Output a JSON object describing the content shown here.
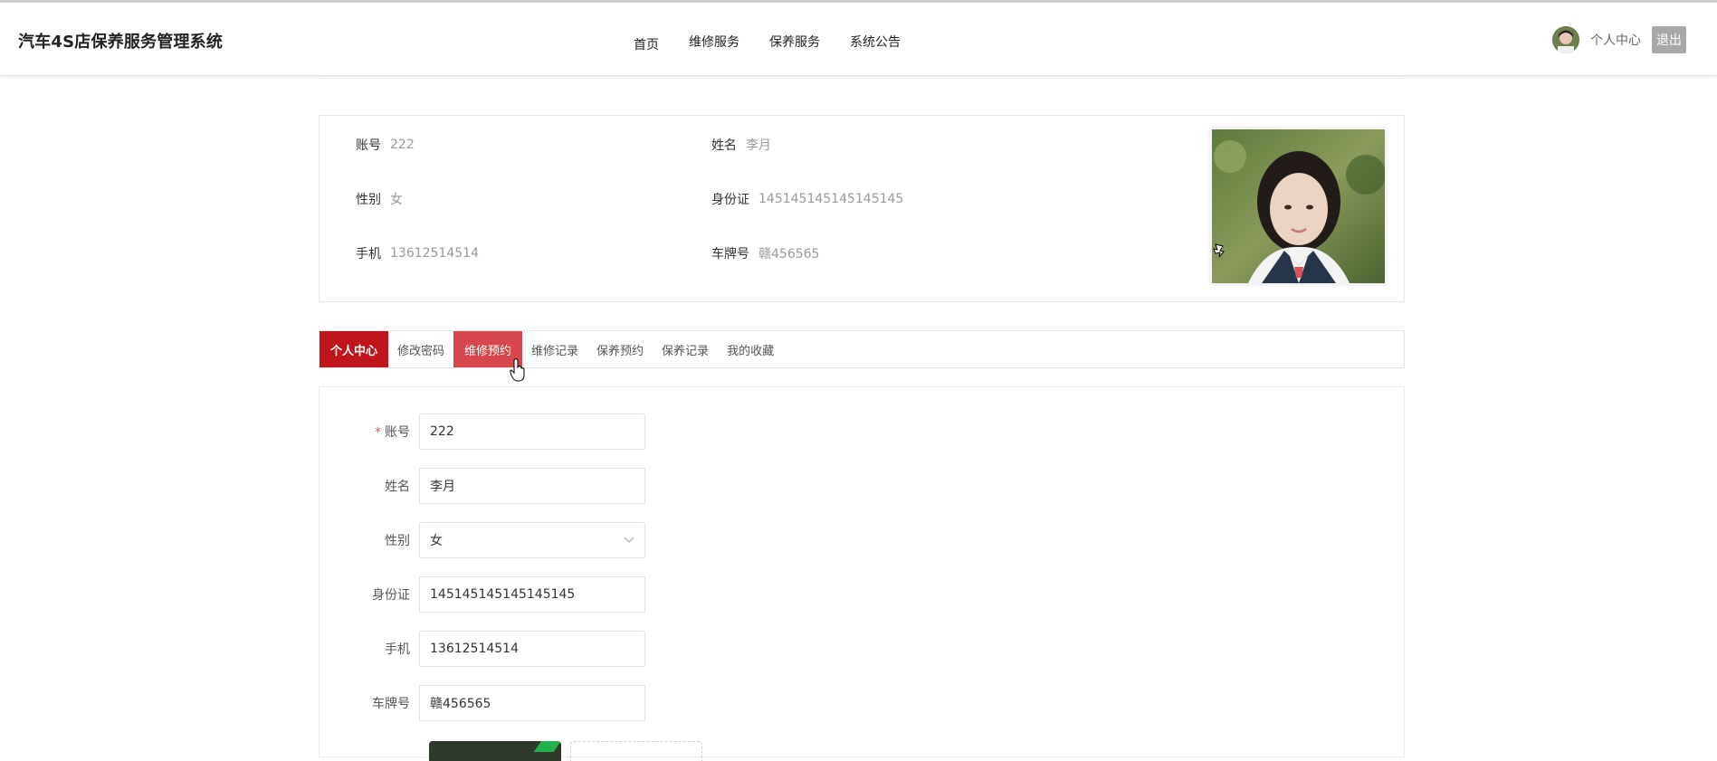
{
  "app": {
    "title": "汽车4S店保养服务管理系统"
  },
  "nav": {
    "items": [
      "首页",
      "维修服务",
      "保养服务",
      "系统公告"
    ]
  },
  "user": {
    "center_label": "个人中心",
    "logout_label": "退出"
  },
  "profile": {
    "account_label": "账号",
    "account_value": "222",
    "name_label": "姓名",
    "name_value": "李月",
    "gender_label": "性别",
    "gender_value": "女",
    "id_label": "身份证",
    "id_value": "145145145145145145",
    "phone_label": "手机",
    "phone_value": "13612514514",
    "plate_label": "车牌号",
    "plate_value": "赣456565"
  },
  "tabs": [
    "个人中心",
    "修改密码",
    "维修预约",
    "维修记录",
    "保养预约",
    "保养记录",
    "我的收藏"
  ],
  "form": {
    "required_mark": "*",
    "fields": [
      {
        "label": "账号",
        "value": "222"
      },
      {
        "label": "姓名",
        "value": "李月"
      },
      {
        "label": "性别",
        "value": "女"
      },
      {
        "label": "身份证",
        "value": "145145145145145145"
      },
      {
        "label": "手机",
        "value": "13612514514"
      },
      {
        "label": "车牌号",
        "value": "赣456565"
      }
    ]
  },
  "colors": {
    "primary": "#c0161b",
    "hover": "#d6464a",
    "logout_bg": "#a8a8a8",
    "upload_badge": "#21b24b"
  }
}
